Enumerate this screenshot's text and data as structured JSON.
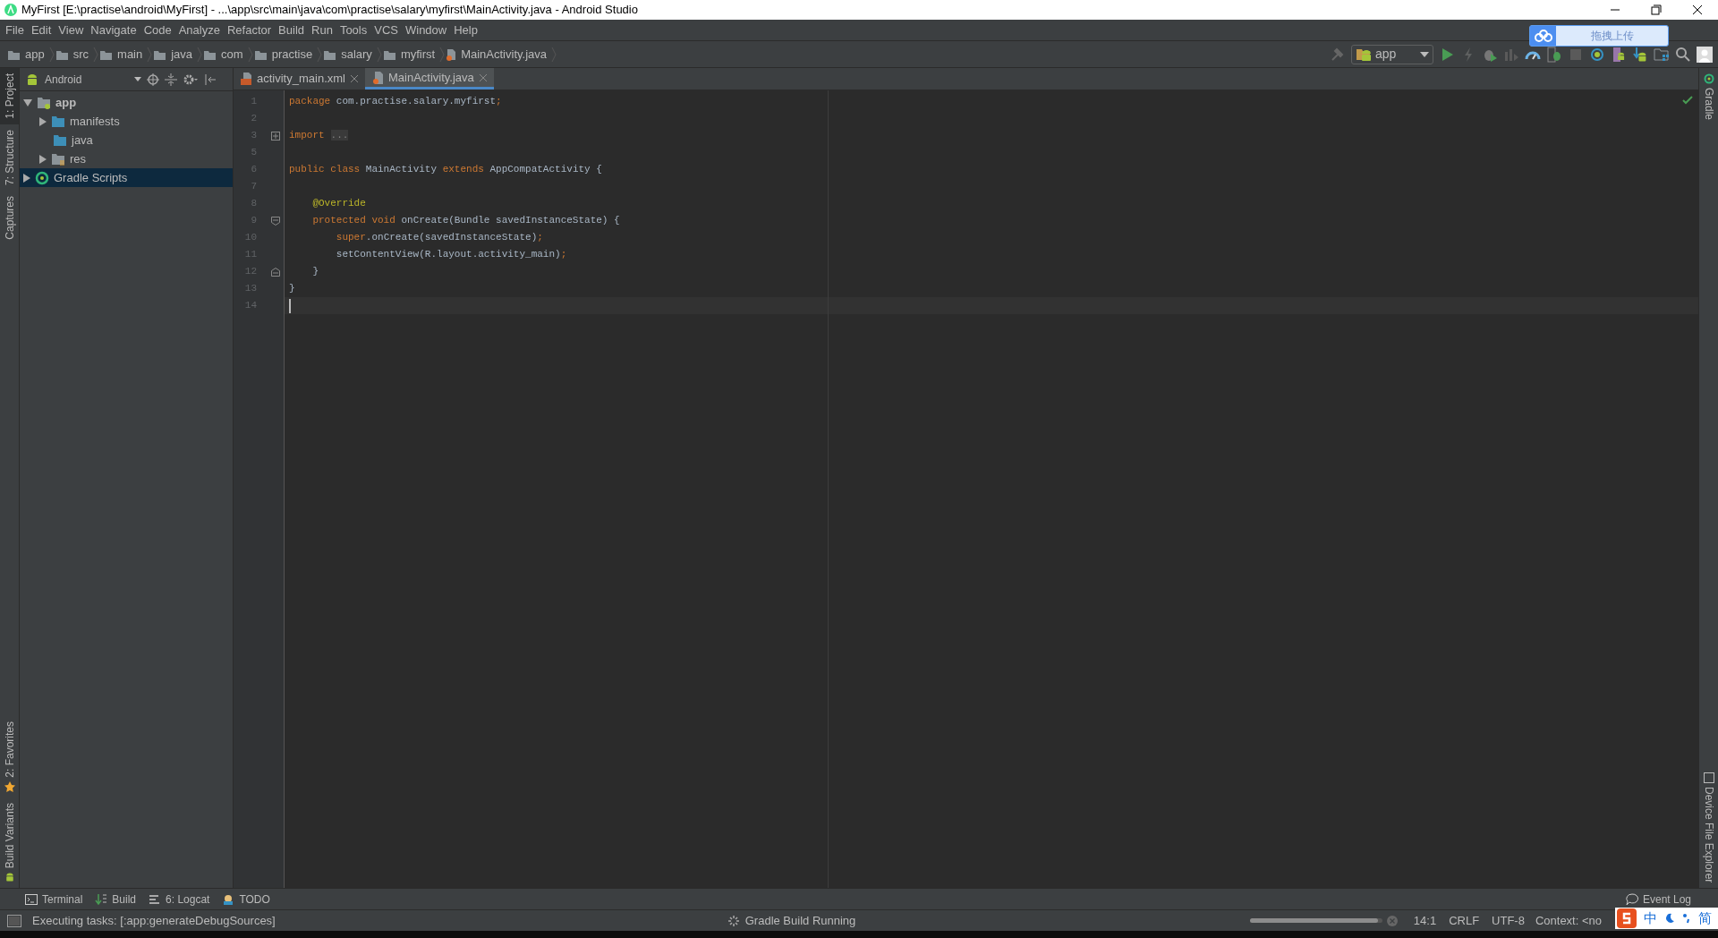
{
  "window": {
    "title": "MyFirst [E:\\practise\\android\\MyFirst] - ...\\app\\src\\main\\java\\com\\practise\\salary\\myfirst\\MainActivity.java - Android Studio"
  },
  "menu": [
    "File",
    "Edit",
    "View",
    "Navigate",
    "Code",
    "Analyze",
    "Refactor",
    "Build",
    "Run",
    "Tools",
    "VCS",
    "Window",
    "Help"
  ],
  "breadcrumb": [
    {
      "label": "app",
      "kind": "folder"
    },
    {
      "label": "src",
      "kind": "folder"
    },
    {
      "label": "main",
      "kind": "folder"
    },
    {
      "label": "java",
      "kind": "folder"
    },
    {
      "label": "com",
      "kind": "folder"
    },
    {
      "label": "practise",
      "kind": "folder"
    },
    {
      "label": "salary",
      "kind": "folder"
    },
    {
      "label": "myfirst",
      "kind": "folder"
    },
    {
      "label": "MainActivity.java",
      "kind": "java"
    }
  ],
  "toolbar": {
    "run_config": "app"
  },
  "upload_popup": {
    "label": "拖拽上传"
  },
  "left_tool_windows": [
    {
      "label": "1: Project",
      "selected": true
    },
    {
      "label": "7: Structure",
      "selected": false
    },
    {
      "label": "Captures",
      "selected": false
    }
  ],
  "left_tool_windows_bottom": [
    {
      "label": "2: Favorites",
      "kind": "favorites"
    },
    {
      "label": "Build Variants",
      "kind": "variants"
    }
  ],
  "project_panel": {
    "view": "Android",
    "tree": [
      {
        "label": "app",
        "kind": "module",
        "expanded": true,
        "selected": false,
        "children": [
          {
            "label": "manifests",
            "kind": "folder",
            "expanded": false,
            "selected": false
          },
          {
            "label": "java",
            "kind": "folder",
            "selected": false
          },
          {
            "label": "res",
            "kind": "res",
            "expanded": false,
            "selected": false
          }
        ]
      },
      {
        "label": "Gradle Scripts",
        "kind": "gradle",
        "expanded": false,
        "selected": true
      }
    ]
  },
  "editor_tabs": [
    {
      "label": "activity_main.xml",
      "kind": "xml",
      "selected": false
    },
    {
      "label": "MainActivity.java",
      "kind": "java",
      "selected": true
    }
  ],
  "code": [
    {
      "number": "1",
      "tokens": [
        {
          "text": "package",
          "kind": "keyword"
        },
        {
          "text": " com.practise.salary.myfirst",
          "kind": "plain"
        },
        {
          "text": ";",
          "kind": "keyword"
        }
      ]
    },
    {
      "number": "2"
    },
    {
      "number": "3",
      "kind": "fold_collapsed",
      "tokens": [
        {
          "text": "import",
          "kind": "keyword"
        },
        {
          "text": "...",
          "kind": "folded"
        }
      ]
    },
    {
      "number": "5"
    },
    {
      "number": "6",
      "tokens": [
        {
          "text": "public class",
          "kind": "keyword"
        },
        {
          "text": " MainActivity ",
          "kind": "plain"
        },
        {
          "text": "extends",
          "kind": "keyword"
        },
        {
          "text": " AppCompatActivity {",
          "kind": "plain"
        }
      ]
    },
    {
      "number": "7"
    },
    {
      "number": "8",
      "tokens": [
        {
          "text": "    @Override",
          "kind": "annotation"
        }
      ]
    },
    {
      "number": "9",
      "kind": "fold_start",
      "tokens": [
        {
          "text": "    protected void",
          "kind": "keyword"
        },
        {
          "text": " onCreate(Bundle savedInstanceState) {",
          "kind": "plain"
        }
      ]
    },
    {
      "number": "10",
      "tokens": [
        {
          "text": "        super",
          "kind": "keyword"
        },
        {
          "text": ".onCreate(savedInstanceState)",
          "kind": "plain"
        },
        {
          "text": ";",
          "kind": "keyword"
        }
      ]
    },
    {
      "number": "11",
      "tokens": [
        {
          "text": "        setContentView(R.layout.activity_main)",
          "kind": "plain"
        },
        {
          "text": ";",
          "kind": "keyword"
        }
      ]
    },
    {
      "number": "12",
      "kind": "fold_end",
      "tokens": [
        {
          "text": "    }",
          "kind": "plain"
        }
      ]
    },
    {
      "number": "13",
      "tokens": [
        {
          "text": "}",
          "kind": "plain"
        }
      ]
    },
    {
      "number": "14",
      "current": true
    }
  ],
  "right_tool_windows": [
    {
      "label": "Gradle",
      "kind": "gradle"
    },
    {
      "label": "Device File Explorer",
      "kind": "device"
    }
  ],
  "bottom_tool_windows": [
    {
      "label": "Terminal",
      "kind": "terminal"
    },
    {
      "label": "Build",
      "kind": "build"
    },
    {
      "label": "6: Logcat",
      "kind": "logcat"
    },
    {
      "label": "TODO",
      "kind": "todo"
    }
  ],
  "event_log": "Event Log",
  "status_bar": {
    "message": "Executing tasks: [:app:generateDebugSources]",
    "task": "Gradle Build Running",
    "progress": {
      "level": 0.97
    },
    "position": "14:1",
    "line_separator": "CRLF",
    "encoding": "UTF-8",
    "context": "Context: <no"
  },
  "ime": {
    "mode": "中",
    "variant": "简"
  }
}
